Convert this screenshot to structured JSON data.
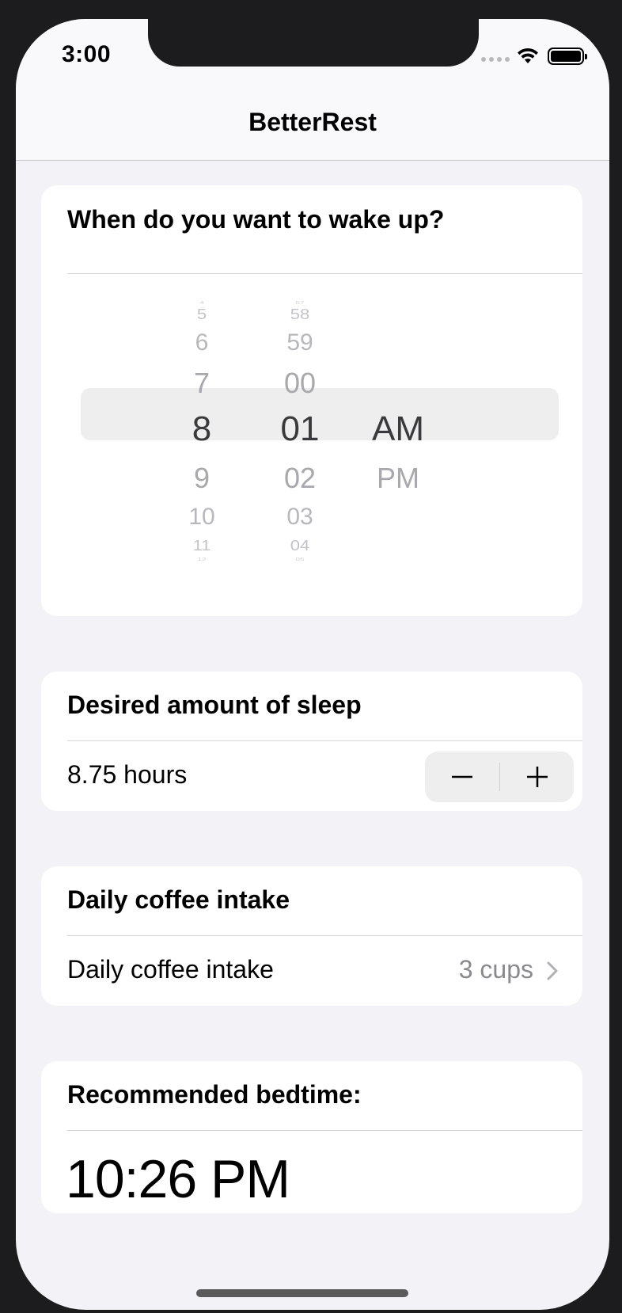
{
  "status_bar": {
    "time": "3:00"
  },
  "nav": {
    "title": "BetterRest"
  },
  "wake_section": {
    "header": "When do you want to wake up?",
    "picker": {
      "hours": [
        "4",
        "5",
        "6",
        "7",
        "8",
        "9",
        "10",
        "11",
        "12"
      ],
      "minutes": [
        "57",
        "58",
        "59",
        "00",
        "01",
        "02",
        "03",
        "04",
        "05"
      ],
      "periods": [
        "AM",
        "PM"
      ],
      "selected": {
        "hour": "8",
        "minute": "01",
        "period": "AM"
      }
    }
  },
  "sleep_section": {
    "header": "Desired amount of sleep",
    "value": "8.75 hours",
    "decrement_label": "−",
    "increment_label": "+"
  },
  "coffee_section": {
    "header": "Daily coffee intake",
    "row_label": "Daily coffee intake",
    "value": "3 cups"
  },
  "result_section": {
    "header": "Recommended bedtime:",
    "bedtime": "10:26 PM"
  },
  "colors": {
    "background": "#f2f2f7",
    "card": "#ffffff",
    "secondary_text": "#8a8a8e"
  }
}
